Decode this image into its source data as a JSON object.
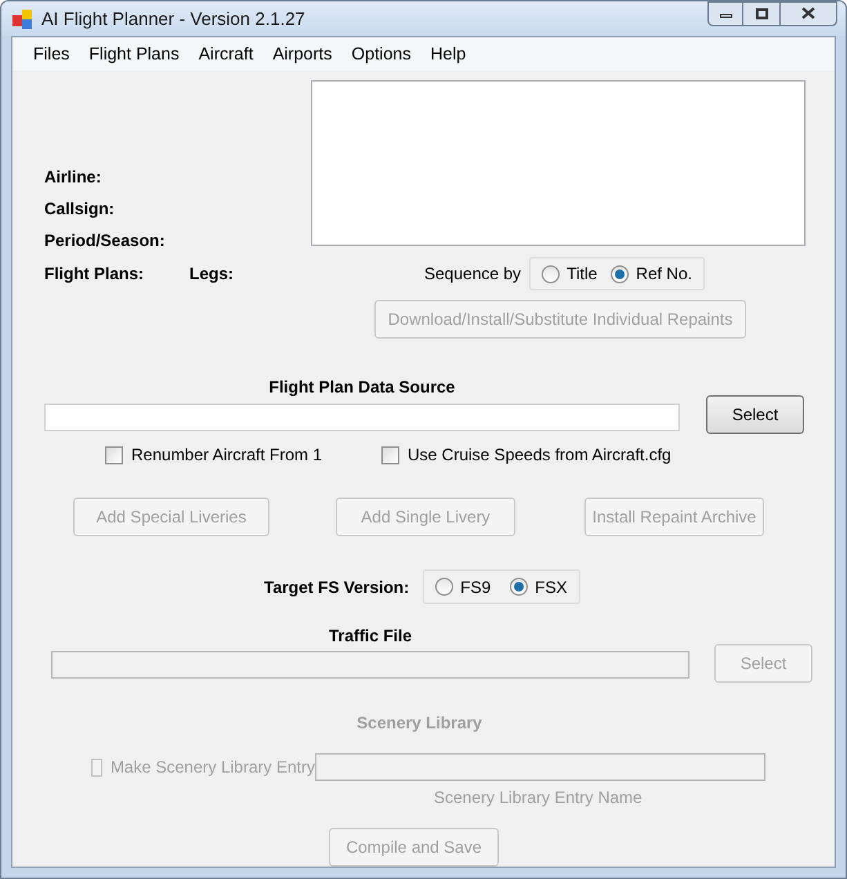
{
  "window": {
    "title": "AI Flight Planner - Version 2.1.27"
  },
  "menu": [
    "Files",
    "Flight Plans",
    "Aircraft",
    "Airports",
    "Options",
    "Help"
  ],
  "info_labels": [
    "Airline:",
    "Callsign:",
    "Period/Season:"
  ],
  "counts": [
    "Flight Plans:",
    "Legs:"
  ],
  "sequence": {
    "label": "Sequence by",
    "options": [
      {
        "label": "Title",
        "selected": false
      },
      {
        "label": "Ref No.",
        "selected": true
      }
    ]
  },
  "repaints_button": {
    "label": "Download/Install/Substitute Individual Repaints",
    "disabled": true
  },
  "data_source": {
    "title": "Flight Plan Data Source",
    "select_button": {
      "label": "Select",
      "disabled": false
    }
  },
  "options": [
    {
      "label": "Renumber Aircraft From 1",
      "checked": false
    },
    {
      "label": "Use Cruise Speeds from Aircraft.cfg",
      "checked": false
    }
  ],
  "livery_buttons": [
    {
      "label": "Add Special Liveries",
      "disabled": true
    },
    {
      "label": "Add Single Livery",
      "disabled": true
    },
    {
      "label": "Install Repaint Archive",
      "disabled": true
    }
  ],
  "target": {
    "label": "Target FS Version:",
    "options": [
      {
        "label": "FS9",
        "selected": false
      },
      {
        "label": "FSX",
        "selected": true
      }
    ]
  },
  "traffic_file": {
    "title": "Traffic File",
    "disabled": true,
    "select_button": {
      "label": "Select",
      "disabled": true
    }
  },
  "scenery": {
    "title": "Scenery Library",
    "disabled": true,
    "checkbox": {
      "label": "Make Scenery Library Entry",
      "checked": false,
      "disabled": true
    },
    "caption": "Scenery Library Entry Name"
  },
  "compile_button": {
    "label": "Compile and Save",
    "disabled": true
  }
}
